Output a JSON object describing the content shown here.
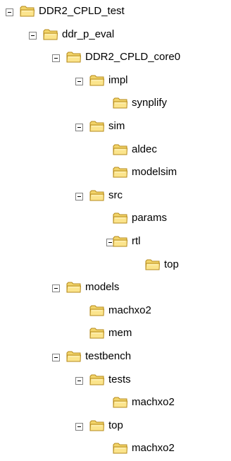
{
  "tree": {
    "nodes": [
      {
        "label": "DDR2_CPLD_test",
        "level": 0,
        "expandable": true
      },
      {
        "label": "ddr_p_eval",
        "level": 1,
        "expandable": true
      },
      {
        "label": "DDR2_CPLD_core0",
        "level": 2,
        "expandable": true
      },
      {
        "label": "impl",
        "level": 3,
        "expandable": true
      },
      {
        "label": "synplify",
        "level": 4,
        "expandable": false
      },
      {
        "label": "sim",
        "level": 3,
        "expandable": true
      },
      {
        "label": "aldec",
        "level": 4,
        "expandable": false
      },
      {
        "label": "modelsim",
        "level": 4,
        "expandable": false
      },
      {
        "label": "src",
        "level": 3,
        "expandable": true
      },
      {
        "label": "params",
        "level": 4,
        "expandable": false
      },
      {
        "label": "rtl",
        "level": 4,
        "expandable": true
      },
      {
        "label": "top",
        "level": 5,
        "expandable": false
      },
      {
        "label": "models",
        "level": 2,
        "expandable": true
      },
      {
        "label": "machxo2",
        "level": 3,
        "expandable": false
      },
      {
        "label": "mem",
        "level": 3,
        "expandable": false
      },
      {
        "label": "testbench",
        "level": 2,
        "expandable": true
      },
      {
        "label": "tests",
        "level": 3,
        "expandable": true
      },
      {
        "label": "machxo2",
        "level": 4,
        "expandable": false
      },
      {
        "label": "top",
        "level": 3,
        "expandable": true
      },
      {
        "label": "machxo2",
        "level": 4,
        "expandable": false
      }
    ]
  },
  "colors": {
    "folder_body": "#f2d46a",
    "folder_edge": "#b58a1a",
    "folder_front": "#fbe48c",
    "toggle_border": "#808080"
  }
}
